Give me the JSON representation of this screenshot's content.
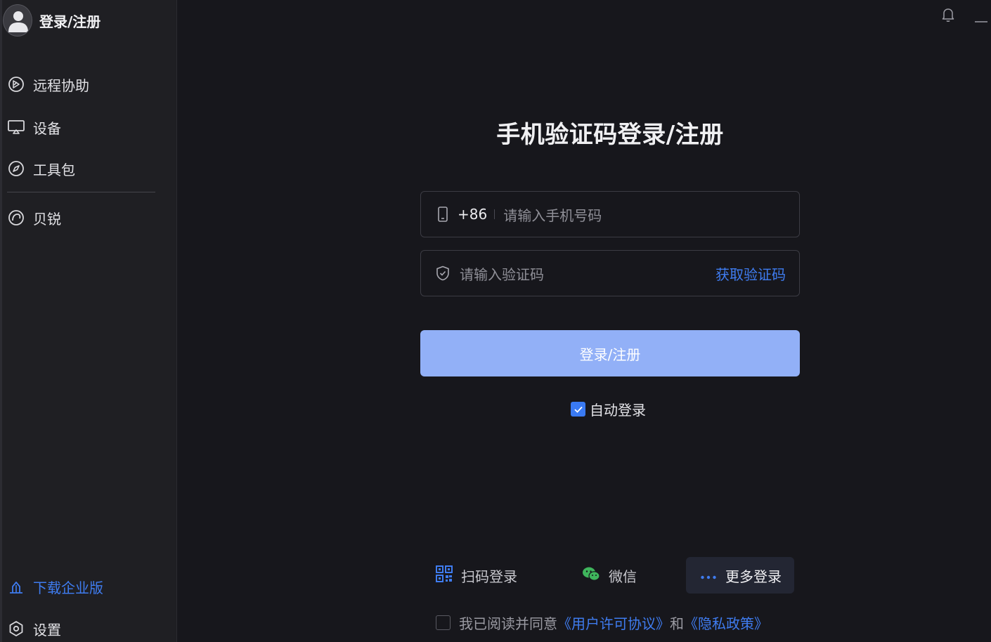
{
  "sidebar": {
    "profile_label": "登录/注册",
    "items": [
      {
        "label": "远程协助",
        "icon": "remote-assist-icon"
      },
      {
        "label": "设备",
        "icon": "monitor-icon"
      },
      {
        "label": "工具包",
        "icon": "compass-icon"
      },
      {
        "label": "贝锐",
        "icon": "oray-logo-icon"
      }
    ],
    "download_label": "下载企业版",
    "settings_label": "设置"
  },
  "login": {
    "title": "手机验证码登录/注册",
    "phone_code": "+86",
    "phone_placeholder": "请输入手机号码",
    "code_placeholder": "请输入验证码",
    "get_code_label": "获取验证码",
    "submit_label": "登录/注册",
    "auto_login_label": "自动登录",
    "auto_login_checked": true
  },
  "alt_login": {
    "qr_label": "扫码登录",
    "wechat_label": "微信",
    "more_label": "更多登录"
  },
  "agreement": {
    "prefix": "我已阅读并同意",
    "license_label": "《用户许可协议》",
    "and": "和",
    "privacy_label": "《隐私政策》",
    "checked": false
  },
  "colors": {
    "accent": "#3f7cf0",
    "button_disabled": "#92b0f7",
    "background": "#17171c",
    "sidebar": "#1f1f23"
  }
}
